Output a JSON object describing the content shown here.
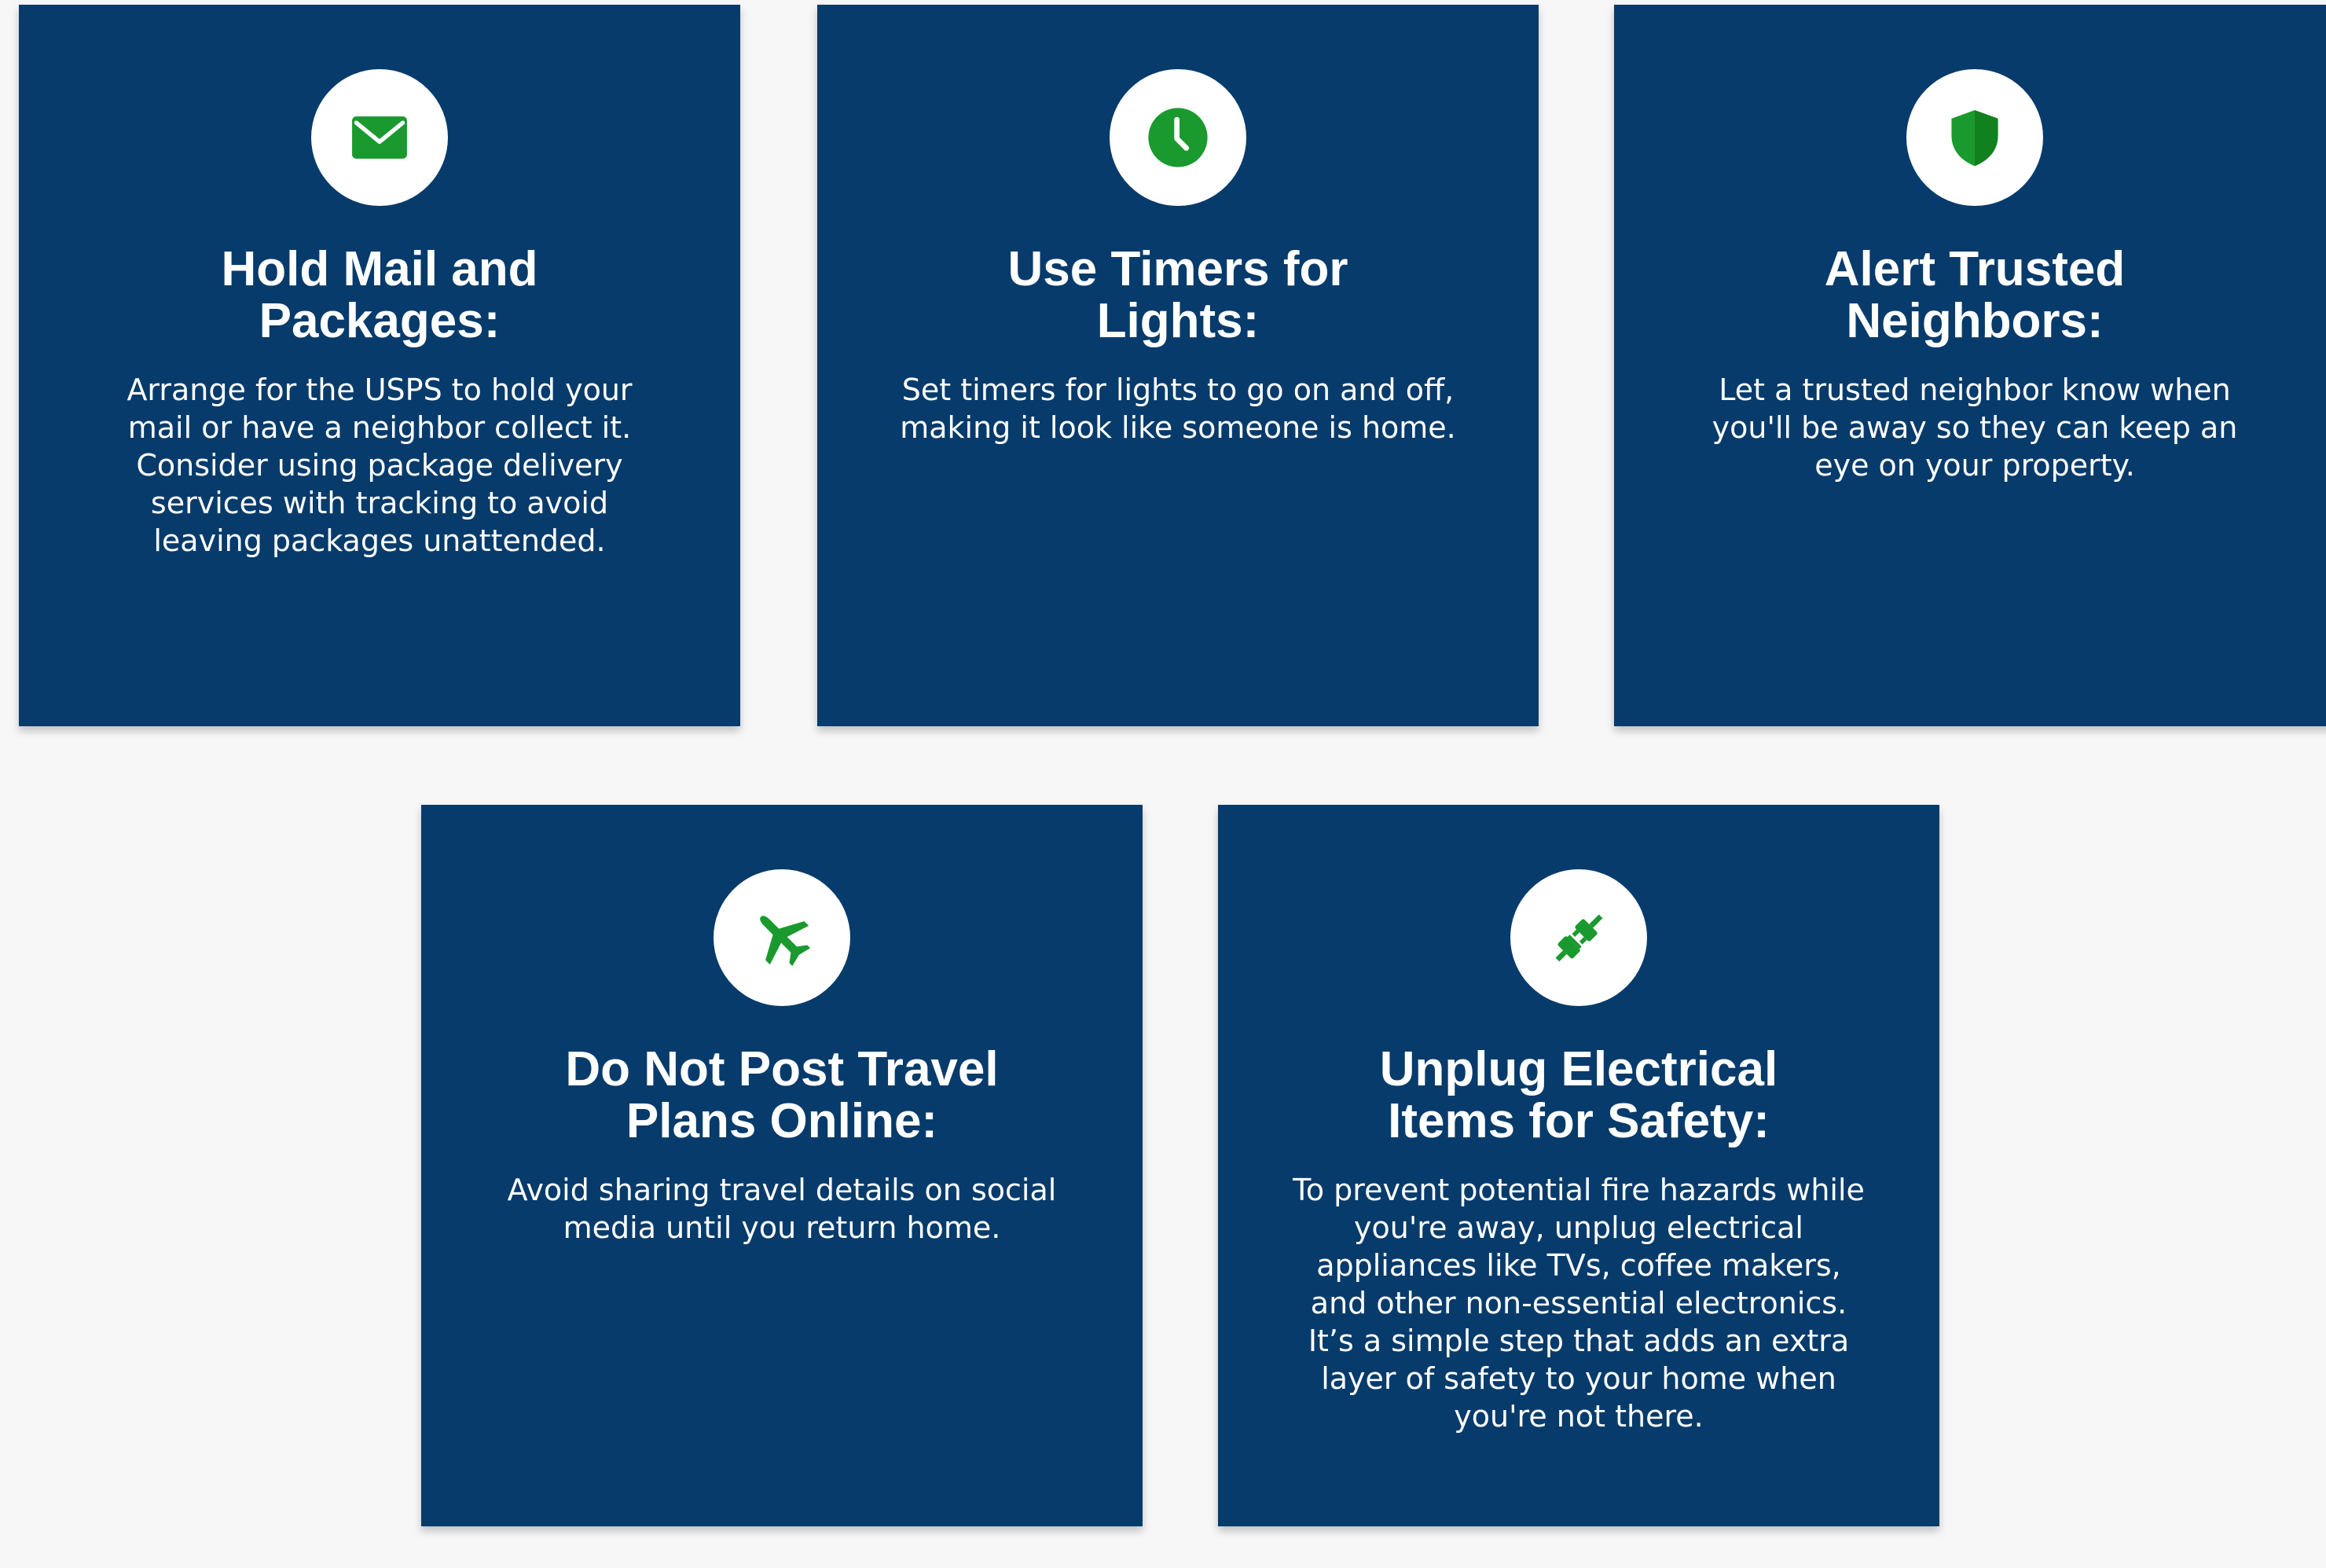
{
  "colors": {
    "page_background": "#f7f7f7",
    "card_background": "#073b6b",
    "icon_background": "#ffffff",
    "icon_color": "#1a9a2e",
    "text": "#ffffff"
  },
  "cards": [
    {
      "icon": "envelope-icon",
      "title": "Hold Mail and Packages:",
      "text": "Arrange for the USPS to hold your mail or have a neighbor collect it. Consider using package delivery services with tracking to avoid leaving packages unattended."
    },
    {
      "icon": "clock-icon",
      "title": "Use Timers for Lights:",
      "text": "Set timers for lights to go on and off, making it look like someone is home."
    },
    {
      "icon": "shield-icon",
      "title": "Alert Trusted Neighbors:",
      "text": "Let a trusted neighbor know when you'll be away so they can keep an eye on your property."
    },
    {
      "icon": "airplane-icon",
      "title": "Do Not Post Travel Plans Online:",
      "text": "Avoid sharing travel details on social media until you return home."
    },
    {
      "icon": "plug-icon",
      "title": "Unplug Electrical Items for Safety:",
      "text": "To prevent potential fire hazards while you're away, unplug electrical appliances like TVs, coffee makers, and other non-essential electronics. It’s a simple step that adds an extra layer of safety to your home when you're not there."
    }
  ]
}
